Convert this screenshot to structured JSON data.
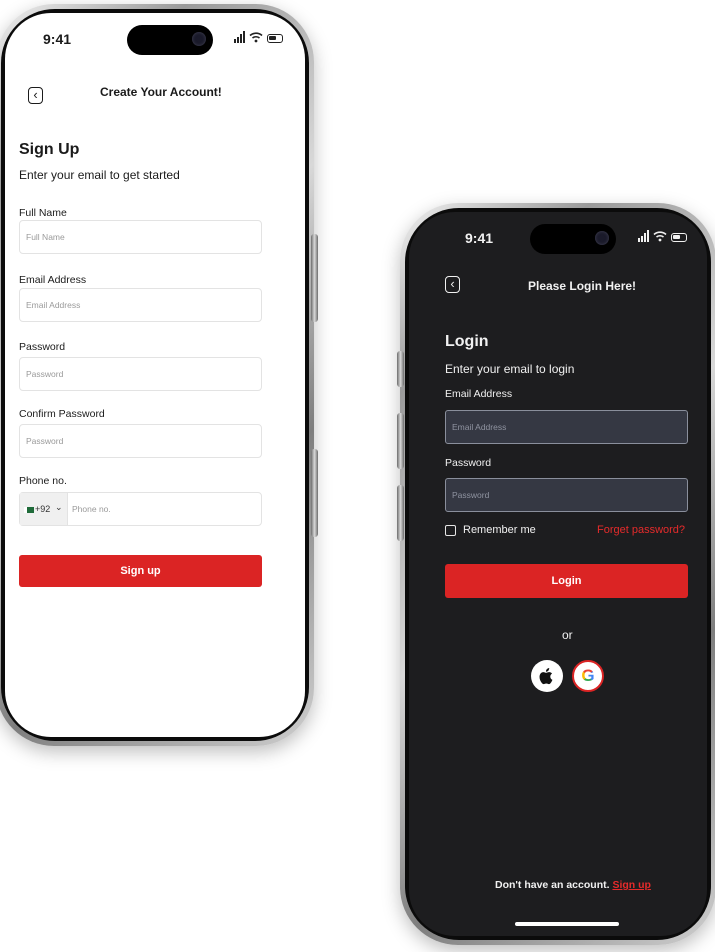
{
  "signup_screen": {
    "status_time": "9:41",
    "header_title": "Create Your Account!",
    "heading": "Sign Up",
    "subheading": "Enter your email to get started",
    "fields": [
      {
        "label": "Full Name",
        "placeholder": "Full Name"
      },
      {
        "label": "Email Address",
        "placeholder": "Email Address"
      },
      {
        "label": "Password",
        "placeholder": "Password"
      },
      {
        "label": "Confirm Password",
        "placeholder": "Password"
      }
    ],
    "phone_field": {
      "label": "Phone no.",
      "country_code": "+92",
      "placeholder": "Phone no."
    },
    "submit_label": "Sign up"
  },
  "login_screen": {
    "status_time": "9:41",
    "header_title": "Please Login Here!",
    "heading": "Login",
    "subheading": "Enter your email to login",
    "fields": [
      {
        "label": "Email Address",
        "placeholder": "Email Address"
      },
      {
        "label": "Password",
        "placeholder": "Password"
      }
    ],
    "remember_label": "Remember me",
    "forget_label": "Forget password?",
    "submit_label": "Login",
    "or_label": "or",
    "footer_text": "Don't have an account.",
    "footer_link": "Sign up"
  },
  "colors": {
    "accent_red": "#db2424",
    "dark_bg": "#1d1d1f",
    "dark_input": "#353843"
  },
  "icons": [
    "back-arrow-icon",
    "signal-icon",
    "wifi-icon",
    "battery-icon",
    "apple-icon",
    "google-icon",
    "pakistan-flag-icon",
    "chevron-down-icon"
  ]
}
